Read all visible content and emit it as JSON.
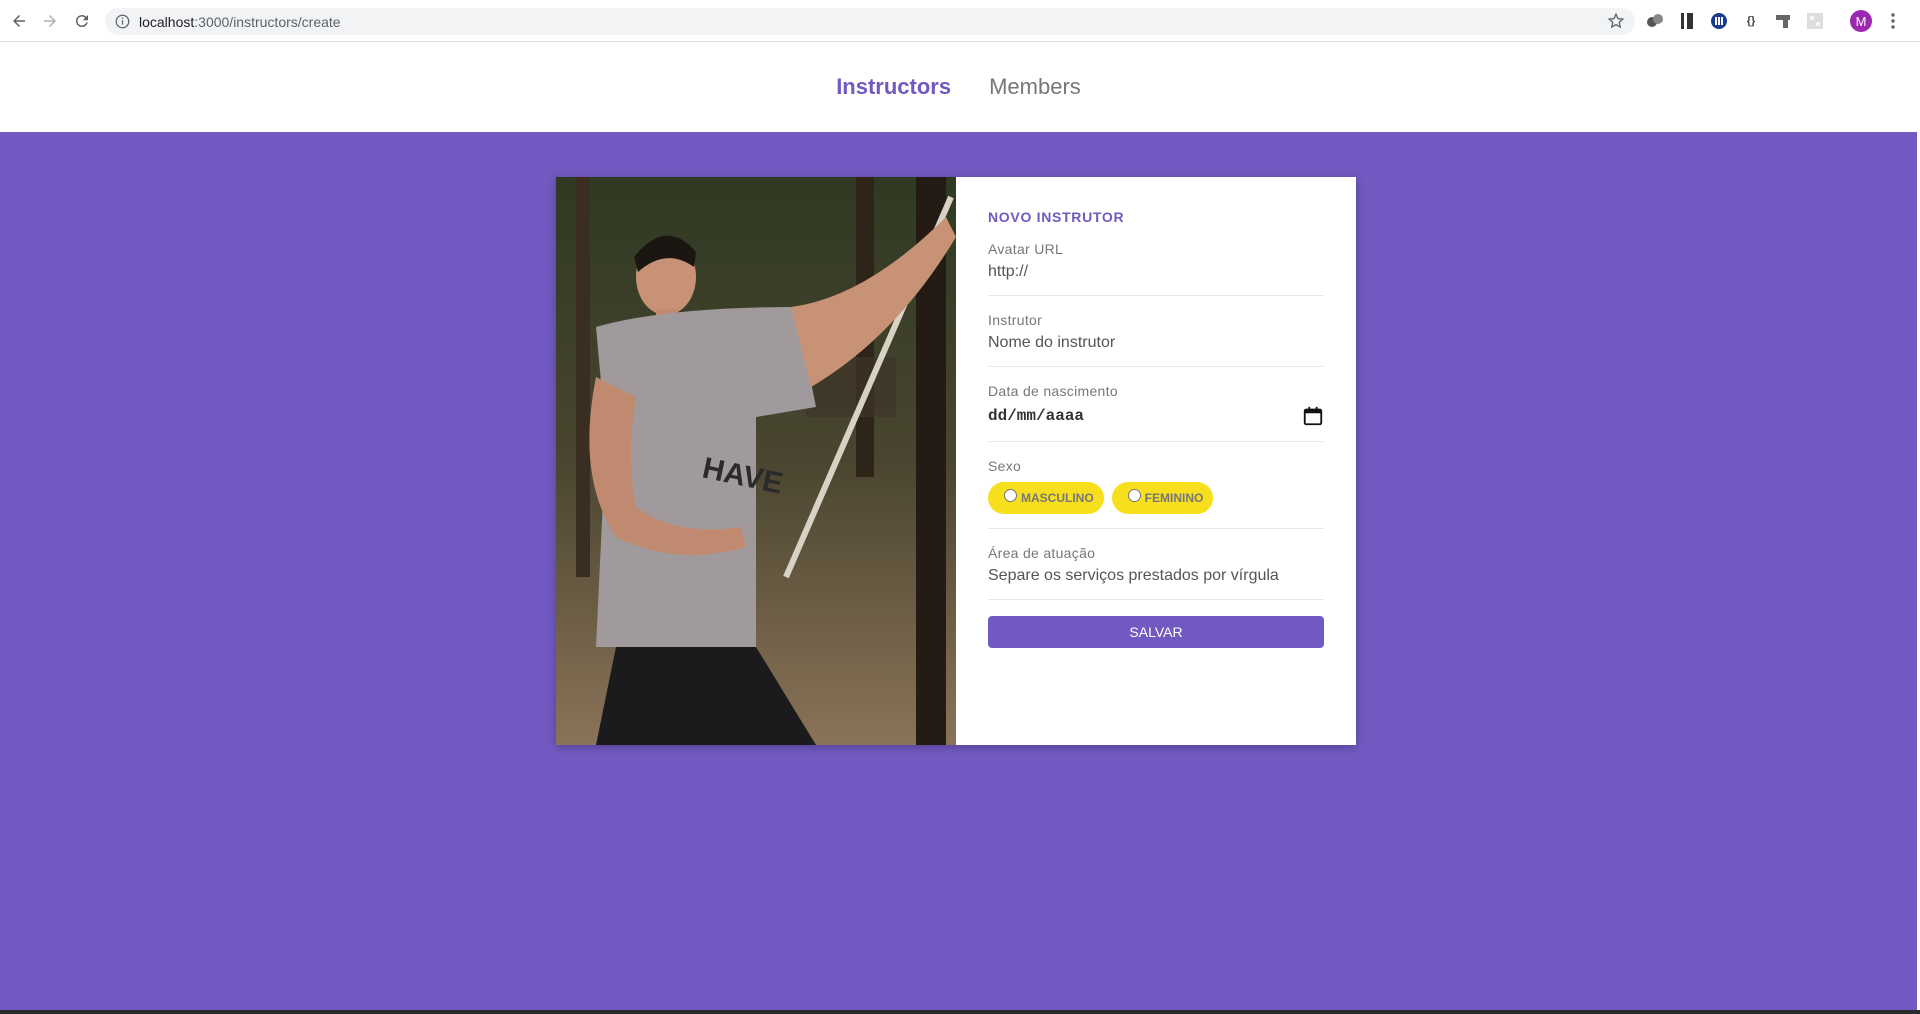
{
  "browser": {
    "url_host": "localhost",
    "url_path": ":3000/instructors/create",
    "avatar_letter": "M"
  },
  "header": {
    "nav": [
      {
        "label": "Instructors",
        "active": true
      },
      {
        "label": "Members",
        "active": false
      }
    ]
  },
  "form": {
    "title": "NOVO INSTRUTOR",
    "avatar": {
      "label": "Avatar URL",
      "placeholder": "http://"
    },
    "name": {
      "label": "Instrutor",
      "placeholder": "Nome do instrutor"
    },
    "birth": {
      "label": "Data de nascimento",
      "value": "dd/mm/aaaa"
    },
    "gender": {
      "label": "Sexo",
      "options": [
        "MASCULINO",
        "FEMININO"
      ]
    },
    "services": {
      "label": "Área de atuação",
      "placeholder": "Separe os serviços prestados por vírgula"
    },
    "submit_label": "SALVAR"
  },
  "colors": {
    "primary": "#7159c1",
    "accent": "#f7df1e"
  }
}
